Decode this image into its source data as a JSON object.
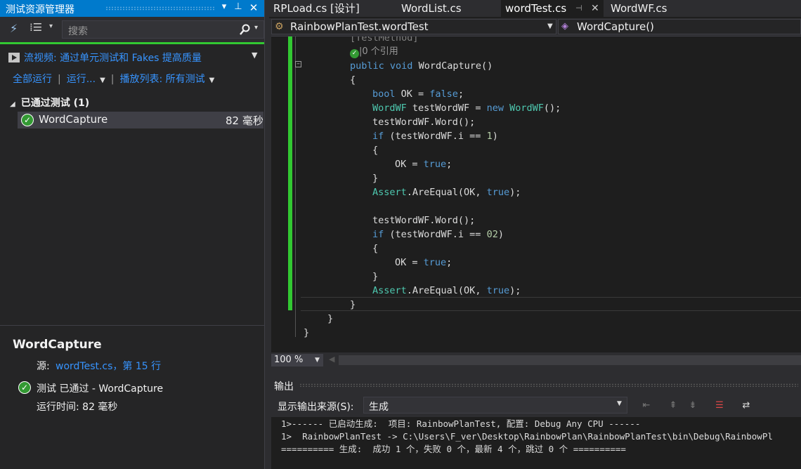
{
  "test_explorer": {
    "title": "测试资源管理器",
    "search_placeholder": "搜索",
    "video_link": "流视频: 通过单元测试和 Fakes 提高质量",
    "run_all": "全部运行",
    "run": "运行...",
    "playlist": "播放列表: 所有测试",
    "group_header": "已通过测试 (1)",
    "test": {
      "name": "WordCapture",
      "duration": "82 毫秒"
    },
    "summary": {
      "title": "WordCapture",
      "source_label": "源:",
      "source_link": "wordTest.cs，第 15 行",
      "status": "测试 已通过 - WordCapture",
      "runtime": "运行时间: 82 毫秒"
    }
  },
  "tabs": [
    {
      "label": "RPLoad.cs [设计]"
    },
    {
      "label": "WordList.cs"
    },
    {
      "label": "wordTest.cs"
    },
    {
      "label": "WordWF.cs"
    }
  ],
  "navbar": {
    "class_path": "RainbowPlanTest.wordTest",
    "member": "WordCapture()"
  },
  "code": {
    "attribute": "[TestMethod]",
    "codelens": "0 个引用",
    "lines": [
      "public void WordCapture()",
      "{",
      "bool OK = false;",
      "WordWF testWordWF = new WordWF();",
      "testWordWF.Word();",
      "if (testWordWF.i == 1)",
      "{",
      "OK = true;",
      "}",
      "Assert.AreEqual(OK, true);",
      "testWordWF.Word();",
      "if (testWordWF.i == 02)",
      "{",
      "OK = true;",
      "}",
      "Assert.AreEqual(OK, true);",
      "}",
      "}",
      "}"
    ]
  },
  "zoom": "100 %",
  "output": {
    "header": "输出",
    "source_label": "显示输出来源(S):",
    "source_value": "生成",
    "lines": [
      "1>------ 已启动生成:  项目: RainbowPlanTest, 配置: Debug Any CPU ------",
      "1>  RainbowPlanTest -> C:\\Users\\F_ver\\Desktop\\RainbowPlan\\RainbowPlanTest\\bin\\Debug\\RainbowPl",
      "========== 生成:  成功 1 个，失败 0 个，最新 4 个，跳过 0 个 =========="
    ]
  },
  "colors": {
    "accent": "#007acc",
    "pass_green": "#32c832",
    "link": "#3794ff",
    "keyword": "#569cd6",
    "type": "#4ec9b0"
  }
}
